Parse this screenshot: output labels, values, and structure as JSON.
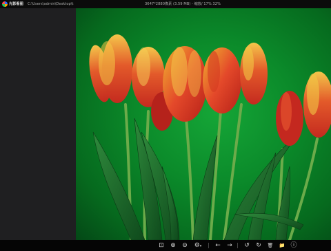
{
  "titlebar": {
    "app_name": "光影看图",
    "path": "C:\\Users\\admin\\Desktop\\t",
    "info": "3647*2880像素 (3.59 MB) - 缩放/ 17% 32%"
  },
  "toolbar": {
    "items": [
      {
        "name": "fit-view-icon",
        "glyph": "⊡"
      },
      {
        "name": "zoom-in-icon",
        "glyph": "⊕"
      },
      {
        "name": "zoom-out-icon",
        "glyph": "⊖"
      },
      {
        "name": "more-icon",
        "glyph": "⚙"
      },
      {
        "name": "previous-icon",
        "glyph": "←"
      },
      {
        "name": "next-icon",
        "glyph": "→"
      },
      {
        "name": "rotate-left-icon",
        "glyph": "↺"
      },
      {
        "name": "rotate-right-icon",
        "glyph": "↻"
      },
      {
        "name": "delete-icon",
        "glyph": "🗑"
      },
      {
        "name": "folder-icon",
        "glyph": "📁"
      },
      {
        "name": "info-icon",
        "glyph": "ⓘ"
      }
    ]
  }
}
